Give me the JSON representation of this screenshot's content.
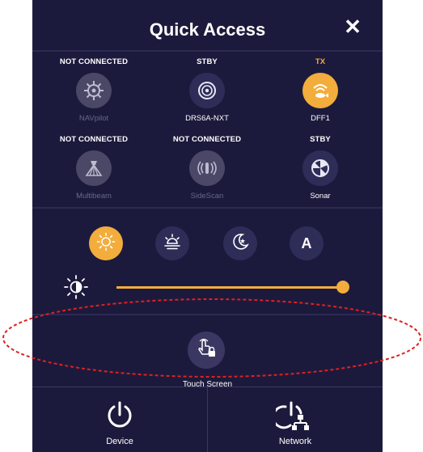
{
  "header": {
    "title": "Quick Access",
    "close_symbol": "✕"
  },
  "devices": [
    {
      "status": "NOT CONNECTED",
      "status_color": "#ffffff",
      "name": "NAVpilot",
      "enabled": false,
      "icon": "helm-icon"
    },
    {
      "status": "STBY",
      "status_color": "#ffffff",
      "name": "DRS6A-NXT",
      "enabled": true,
      "icon": "radar-icon"
    },
    {
      "status": "TX",
      "status_color": "#f2ad3c",
      "name": "DFF1",
      "enabled": true,
      "icon": "fish-finder-icon"
    },
    {
      "status": "NOT CONNECTED",
      "status_color": "#ffffff",
      "name": "Multibeam",
      "enabled": false,
      "icon": "multibeam-icon"
    },
    {
      "status": "NOT CONNECTED",
      "status_color": "#ffffff",
      "name": "SideScan",
      "enabled": false,
      "icon": "sidescan-icon"
    },
    {
      "status": "STBY",
      "status_color": "#ffffff",
      "name": "Sonar",
      "enabled": true,
      "icon": "sonar-icon"
    }
  ],
  "display_modes": [
    {
      "name": "day",
      "icon": "sun-icon",
      "active": true
    },
    {
      "name": "dusk",
      "icon": "sunset-icon",
      "active": false
    },
    {
      "name": "night",
      "icon": "moon-icon",
      "active": false
    },
    {
      "name": "auto",
      "label": "A",
      "active": false
    }
  ],
  "brightness": {
    "level": 1.0,
    "icon": "brightness-icon"
  },
  "touch_screen": {
    "label": "Touch Screen",
    "icon": "touch-lock-icon"
  },
  "bottom": {
    "device_label": "Device",
    "network_label": "Network"
  },
  "colors": {
    "panel_bg": "#1c1a3c",
    "accent": "#f2ad3c",
    "highlight_ellipse": "#e02020"
  }
}
